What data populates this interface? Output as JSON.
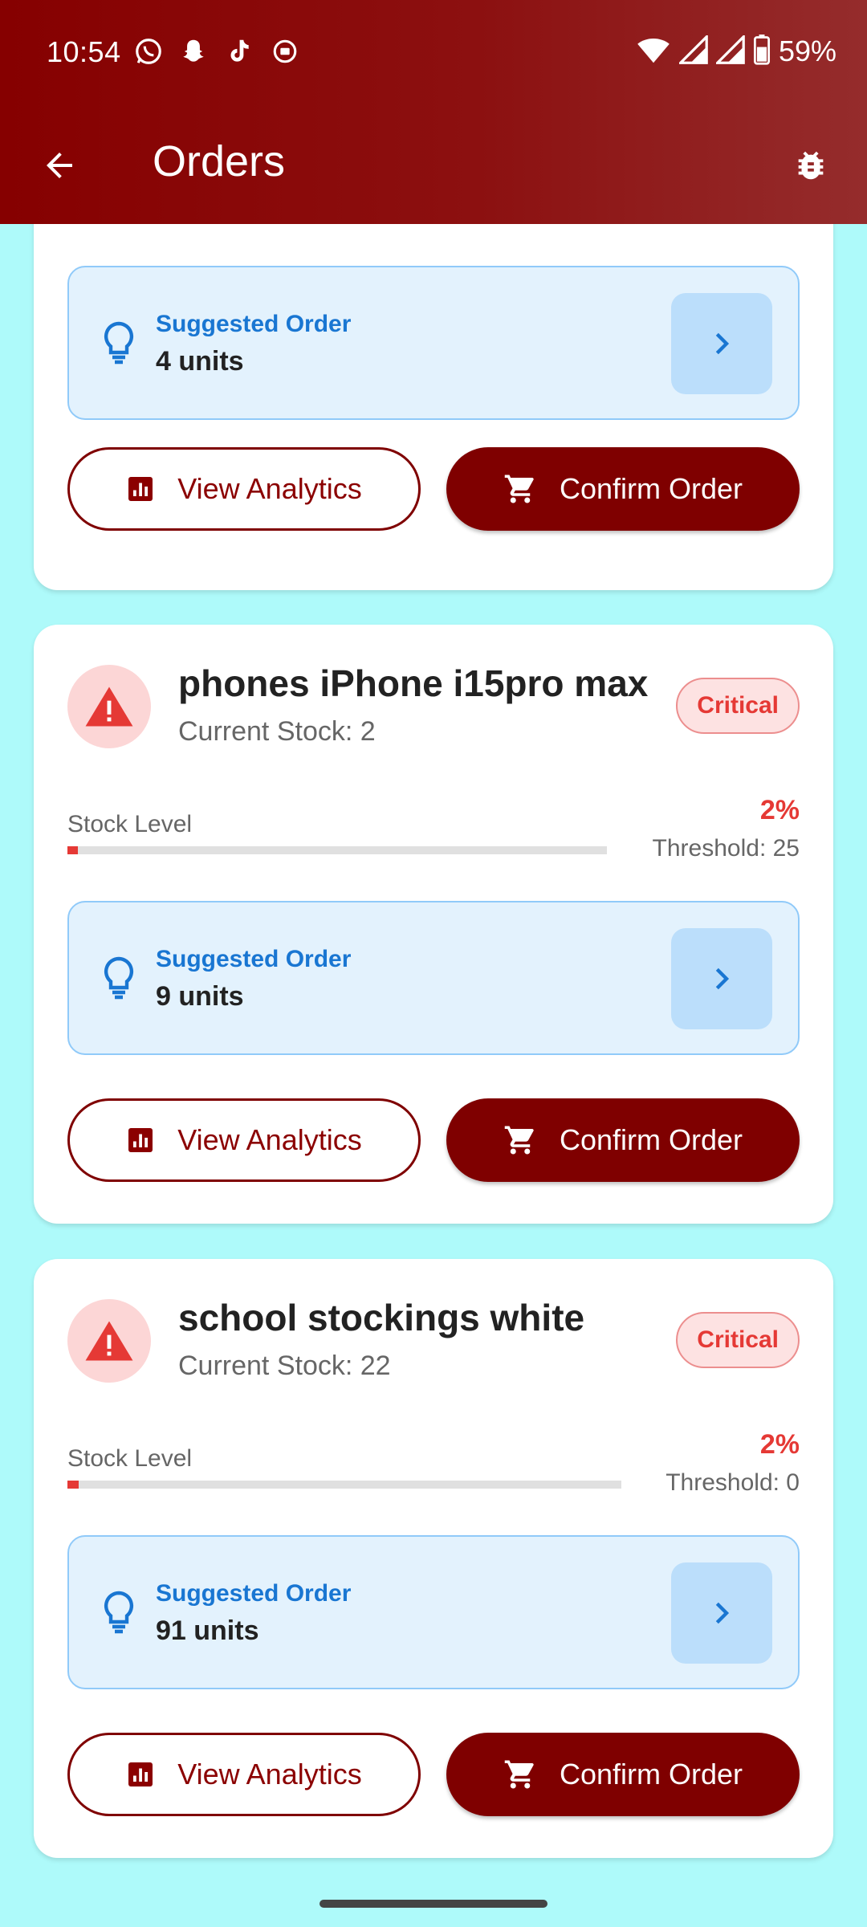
{
  "status_bar": {
    "time": "10:54",
    "battery": "59%",
    "notification_icons": [
      "whatsapp-icon",
      "snapchat-icon",
      "tiktok-icon",
      "record-icon"
    ]
  },
  "app_bar": {
    "title": "Orders",
    "back_icon": "arrow-back-icon",
    "action_icon": "bug-icon"
  },
  "labels": {
    "stock_level": "Stock Level",
    "suggested_order": "Suggested Order",
    "view_analytics": "View Analytics",
    "confirm_order": "Confirm Order"
  },
  "cards": [
    {
      "suggested_units": "4 units"
    },
    {
      "name": "phones iPhone i15pro max",
      "current_stock": "Current Stock: 2",
      "badge": "Critical",
      "stock_percent": "2%",
      "stock_fraction": 0.02,
      "threshold": "Threshold: 25",
      "suggested_units": "9 units"
    },
    {
      "name": "school stockings white",
      "current_stock": "Current Stock: 22",
      "badge": "Critical",
      "stock_percent": "2%",
      "stock_fraction": 0.02,
      "threshold": "Threshold: 0",
      "suggested_units": "91 units"
    }
  ],
  "colors": {
    "primary": "#7f0000",
    "critical": "#e53935",
    "info": "#1976d2",
    "background": "#aefafa"
  }
}
